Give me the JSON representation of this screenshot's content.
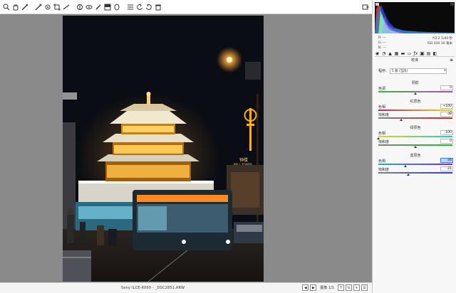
{
  "toolbar": {
    "icons": [
      "zoom-icon",
      "hand-icon",
      "white-balance-icon",
      "color-sampler-icon",
      "target-adjust-icon",
      "crop-icon",
      "straighten-icon",
      "spot-removal-icon",
      "red-eye-icon",
      "adjustment-brush-icon",
      "graduated-filter-icon",
      "radial-filter-icon",
      "preferences-icon",
      "rotate-left-icon",
      "rotate-right-icon",
      "trash-icon"
    ],
    "fullscreen_icon": "fullscreen-icon"
  },
  "status": {
    "filename": "Sony ILCE-6000 - _DSC2851.ARW",
    "page": "图像 1/1",
    "btn_y": "Y",
    "btn_plus": "+"
  },
  "info": {
    "r_label": "R:",
    "r_value": "---",
    "g_label": "G:",
    "g_value": "---",
    "b_label": "B:",
    "b_value": "---",
    "exposure": "f/2.2  1/40 秒",
    "iso_line": "ISO 200  30 毫米"
  },
  "panel": {
    "title": "校准",
    "process_label": "程序:",
    "process_value": "5 版 (当前)"
  },
  "shadows": {
    "title": "阴影",
    "tint_label": "色调",
    "tint_value": "0"
  },
  "red": {
    "title": "红原色",
    "hue_label": "色相",
    "hue_value": "+100",
    "sat_label": "饱和度",
    "sat_value": "-38"
  },
  "green": {
    "title": "绿原色",
    "hue_label": "色相",
    "hue_value": "-100",
    "sat_label": "饱和度",
    "sat_value": "0"
  },
  "blue": {
    "title": "蓝原色",
    "hue_label": "色相",
    "hue_value": "-26",
    "sat_label": "饱和度",
    "sat_value": "-21"
  },
  "photo_signs": {
    "bell_tower_cn": "钟楼",
    "bell_tower_en": "BELL TOWER"
  }
}
